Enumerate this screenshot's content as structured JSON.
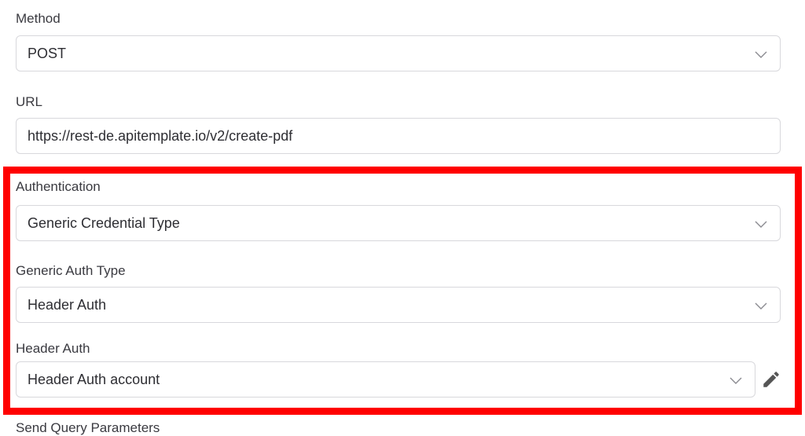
{
  "method": {
    "label": "Method",
    "value": "POST"
  },
  "url": {
    "label": "URL",
    "value": "https://rest-de.apitemplate.io/v2/create-pdf"
  },
  "authentication": {
    "label": "Authentication",
    "value": "Generic Credential Type"
  },
  "generic_auth_type": {
    "label": "Generic Auth Type",
    "value": "Header Auth"
  },
  "header_auth": {
    "label": "Header Auth",
    "value": "Header Auth account",
    "edit_icon": "pencil-icon"
  },
  "next_section": {
    "label": "Send Query Parameters"
  },
  "colors": {
    "highlight": "#ff0000",
    "border": "#d8d8dc",
    "text": "#2e2e33",
    "icon": "#555555"
  },
  "icons": {
    "select": "chevron-down-icon"
  }
}
